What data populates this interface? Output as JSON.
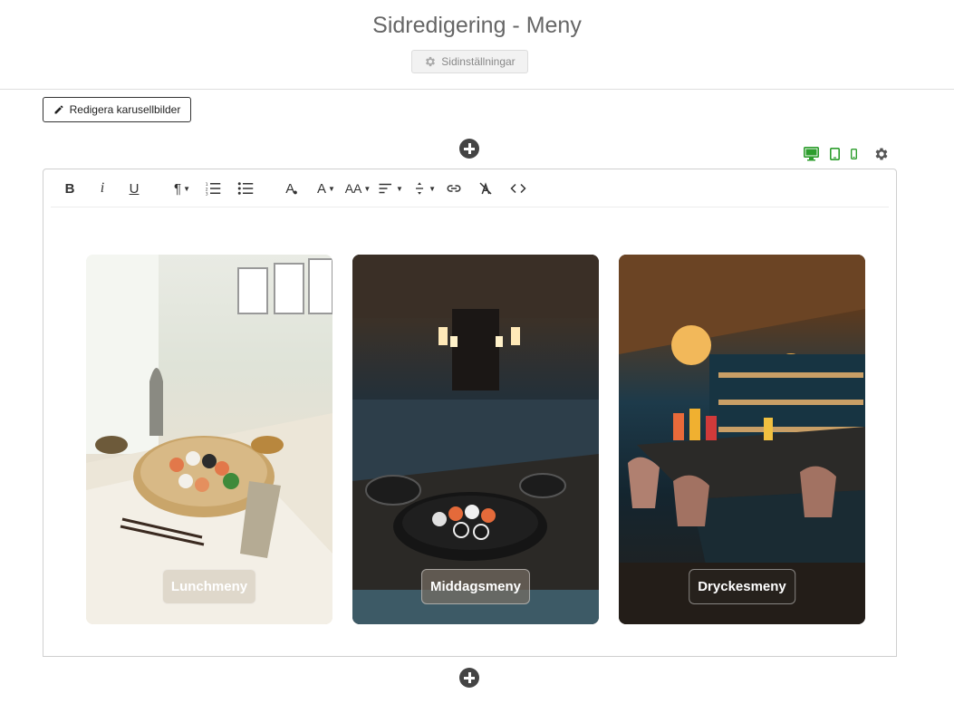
{
  "header": {
    "title": "Sidredigering - Meny",
    "settings_label": "Sidinställningar"
  },
  "carousel": {
    "edit_label": "Redigera karusellbilder"
  },
  "colors": {
    "device_active": "#2e9e2e",
    "toolbar_text": "#333333",
    "add_circle": "#444444"
  },
  "toolbar": {
    "bold": "B",
    "italic": "i",
    "underline": "U",
    "paragraph": "¶",
    "font_color": "A",
    "font_size": "AA"
  },
  "cards": [
    {
      "label": "Lunchmeny",
      "image": "lunch-table-sushi-photo"
    },
    {
      "label": "Middagsmeny",
      "image": "dinner-restaurant-sushi-photo"
    },
    {
      "label": "Dryckesmeny",
      "image": "cocktail-bar-photo"
    }
  ]
}
